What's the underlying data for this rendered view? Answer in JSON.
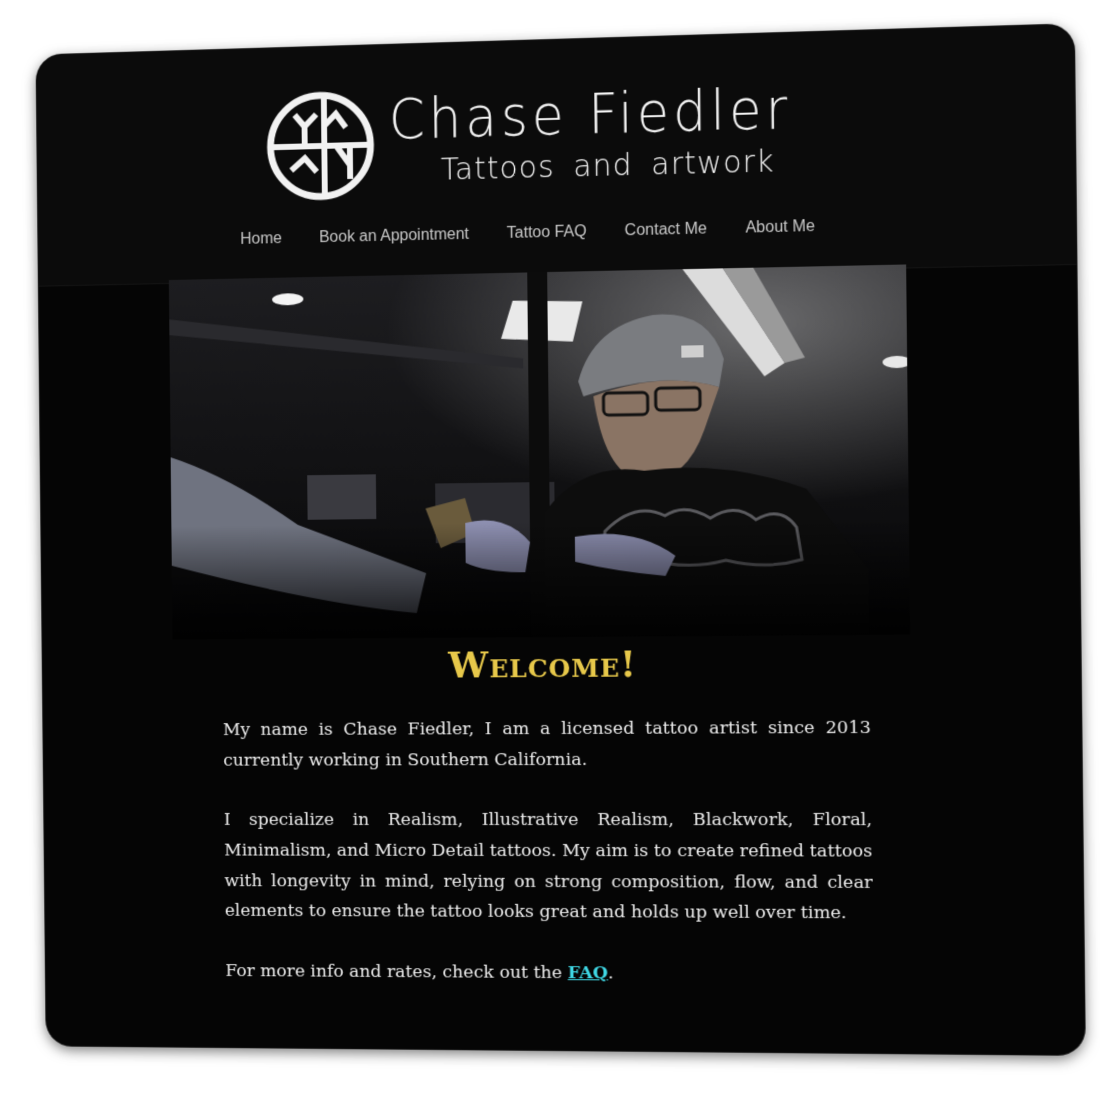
{
  "brand": {
    "name": "Chase Fiedler",
    "tagline": "Tattoos and artwork"
  },
  "nav": {
    "items": [
      {
        "label": "Home"
      },
      {
        "label": "Book an Appointment"
      },
      {
        "label": "Tattoo FAQ"
      },
      {
        "label": "Contact Me"
      },
      {
        "label": "About Me"
      }
    ]
  },
  "main": {
    "heading": "Welcome!",
    "intro": "My name is Chase Fiedler, I am a licensed tattoo artist since 2013 currently working in Southern California.",
    "specialties": "I specialize in Realism, Illustrative Realism, Blackwork, Floral, Minimalism, and Micro Detail tattoos. My aim is to create refined tattoos with longevity in mind, relying on strong composition, flow, and clear elements to ensure the tattoo looks great and holds up well over time.",
    "more_info_prefix": "For more info and rates, check out the ",
    "faq_link": "FAQ",
    "more_info_suffix": "."
  },
  "colors": {
    "background": "#050505",
    "heading": "#e7c84a",
    "link": "#3fd6e3",
    "text": "#eeeeee"
  },
  "icons": {
    "logo": "circle-sigil-logo-icon"
  }
}
